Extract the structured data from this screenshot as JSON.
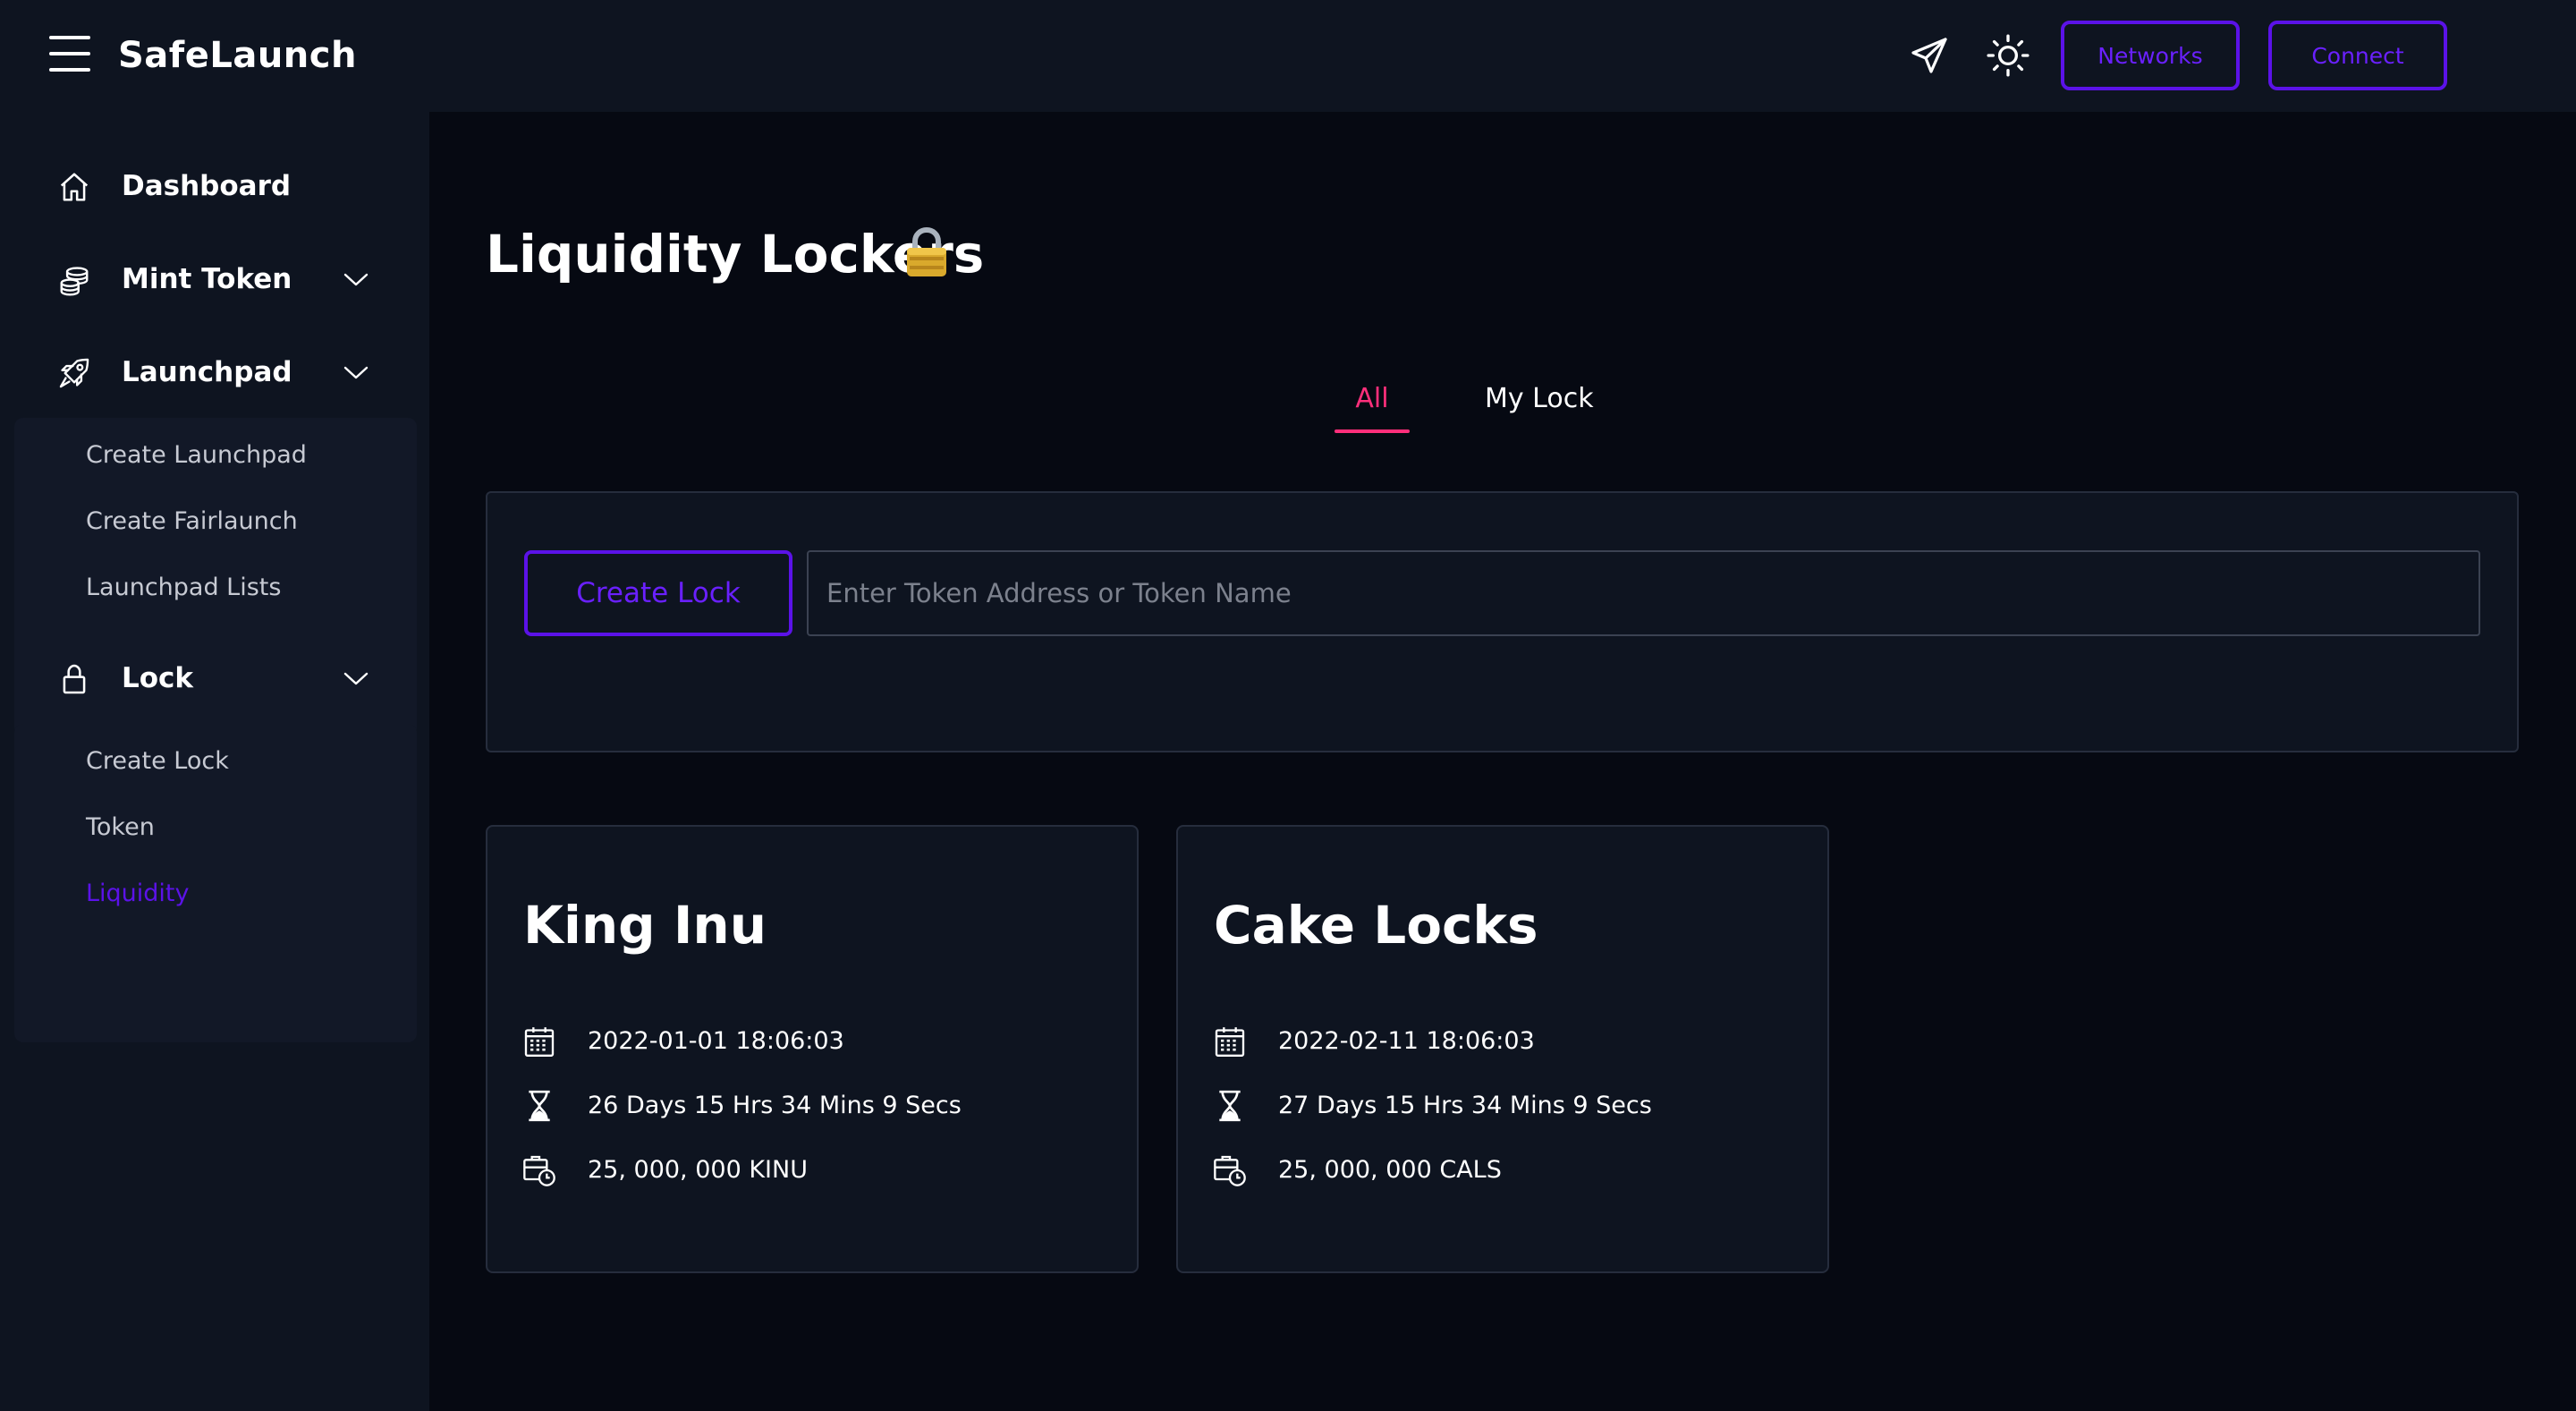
{
  "app": {
    "brand": "SafeLaunch",
    "menu_icon": "hamburger-menu-icon"
  },
  "header": {
    "telegram_icon": "paper-plane-icon",
    "theme_icon": "sun-icon",
    "networks_label": "Networks",
    "connect_label": "Connect",
    "accent_color": "#5b12e8"
  },
  "sidebar": {
    "items": [
      {
        "label": "Dashboard",
        "icon": "home-icon"
      },
      {
        "label": "Mint Token",
        "icon": "coins-icon",
        "expandable": true
      },
      {
        "label": "Launchpad",
        "icon": "rocket-icon",
        "expandable": true,
        "children": [
          "Create Launchpad",
          "Create Fairlaunch",
          "Launchpad Lists"
        ]
      },
      {
        "label": "Lock",
        "icon": "lock-icon",
        "expandable": true,
        "children": [
          "Create Lock",
          "Token",
          "Liquidity"
        ],
        "active_child": "Liquidity"
      }
    ]
  },
  "page": {
    "title": "Liquidity Lockers",
    "title_emoji": "🔒"
  },
  "tabs": {
    "items": [
      "All",
      "My Lock"
    ],
    "active": "All",
    "active_color": "#ff2f7b"
  },
  "toolbar": {
    "create_lock_label": "Create Lock",
    "search_placeholder": "Enter Token Address or Token Name"
  },
  "locks": [
    {
      "name": "King Inu",
      "date": "2022-01-01 18:06:03",
      "remaining": "26 Days 15 Hrs 34 Mins 9 Secs",
      "amount": "25, 000, 000 KINU"
    },
    {
      "name": "Cake Locks",
      "date": "2022-02-11 18:06:03",
      "remaining": "27 Days 15 Hrs 34 Mins 9 Secs",
      "amount": "25, 000, 000 CALS"
    }
  ]
}
